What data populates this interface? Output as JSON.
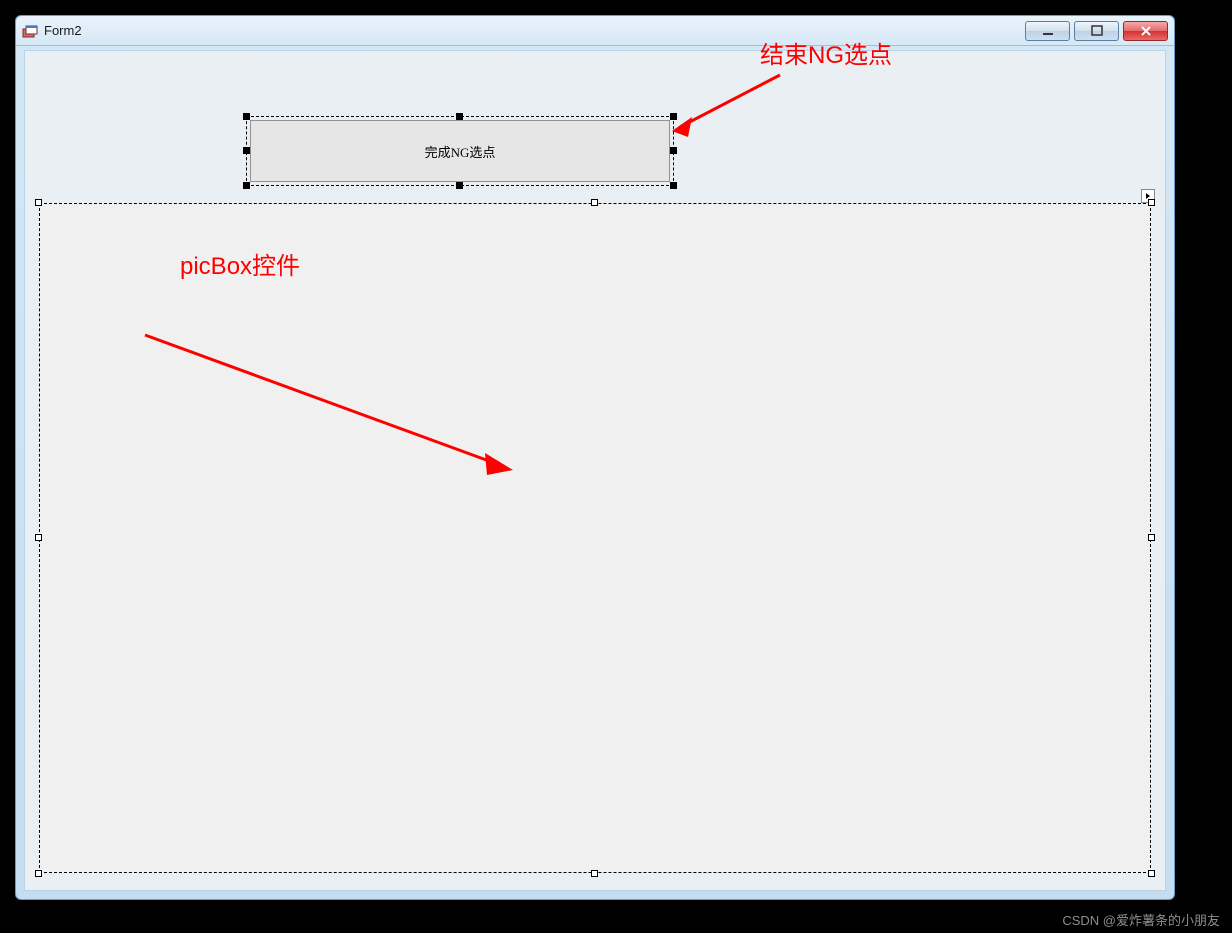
{
  "window": {
    "title": "Form2"
  },
  "controls": {
    "ng_button_label": "完成NG选点"
  },
  "annotations": {
    "button_note": "结束NG选点",
    "picbox_note": "picBox控件"
  },
  "watermark": "CSDN @爱炸薯条的小朋友"
}
